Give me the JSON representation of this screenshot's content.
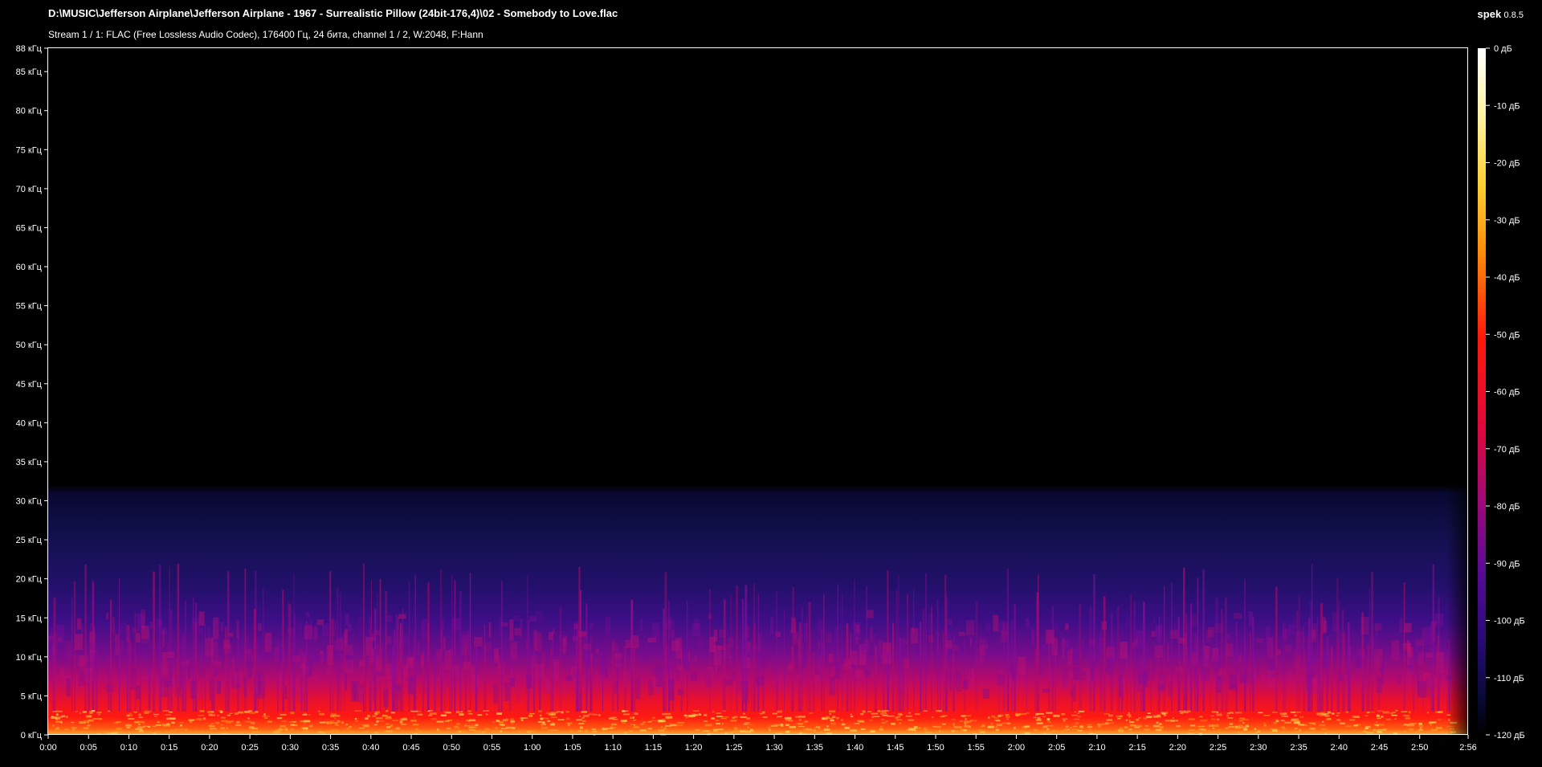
{
  "window": {
    "title": "D:\\MUSIC\\Jefferson Airplane\\Jefferson Airplane - 1967 - Surrealistic Pillow (24bit-176,4)\\02 - Somebody to Love.flac",
    "subtitle": "Stream 1 / 1: FLAC (Free Lossless Audio Codec), 176400 Гц, 24 бита, channel 1 / 2, W:2048, F:Hann",
    "app_name": "spek",
    "app_version": "0.8.5"
  },
  "colors": {
    "background": "#000000",
    "axis": "#ffffff",
    "text": "#ffffff",
    "palette": [
      "#000000",
      "#0a0a3c",
      "#2a0a78",
      "#5a0a96",
      "#a0087a",
      "#e00a3a",
      "#ff2a0a",
      "#ff8a0a",
      "#ffd040",
      "#ffffe8"
    ]
  },
  "chart_data": {
    "type": "heatmap",
    "y_axis": {
      "unit": "кГц",
      "ticks": [
        "0 кГц",
        "5 кГц",
        "10 кГц",
        "15 кГц",
        "20 кГц",
        "25 кГц",
        "30 кГц",
        "35 кГц",
        "40 кГц",
        "45 кГц",
        "50 кГц",
        "55 кГц",
        "60 кГц",
        "65 кГц",
        "70 кГц",
        "75 кГц",
        "80 кГц",
        "85 кГц",
        "88 кГц"
      ],
      "range": [
        0,
        88
      ]
    },
    "x_axis": {
      "ticks": [
        "0:00",
        "0:05",
        "0:10",
        "0:15",
        "0:20",
        "0:25",
        "0:30",
        "0:35",
        "0:40",
        "0:45",
        "0:50",
        "0:55",
        "1:00",
        "1:05",
        "1:10",
        "1:15",
        "1:20",
        "1:25",
        "1:30",
        "1:35",
        "1:40",
        "1:45",
        "1:50",
        "1:55",
        "2:00",
        "2:05",
        "2:10",
        "2:15",
        "2:20",
        "2:25",
        "2:30",
        "2:35",
        "2:40",
        "2:45",
        "2:50",
        "2:56"
      ],
      "range_seconds": [
        0,
        176
      ]
    },
    "colorbar": {
      "unit": "дБ",
      "ticks": [
        "0 дБ",
        "-10 дБ",
        "-20 дБ",
        "-30 дБ",
        "-40 дБ",
        "-50 дБ",
        "-60 дБ",
        "-70 дБ",
        "-80 дБ",
        "-90 дБ",
        "-100 дБ",
        "-110 дБ",
        "-120 дБ"
      ],
      "range": [
        -120,
        0
      ]
    }
  }
}
